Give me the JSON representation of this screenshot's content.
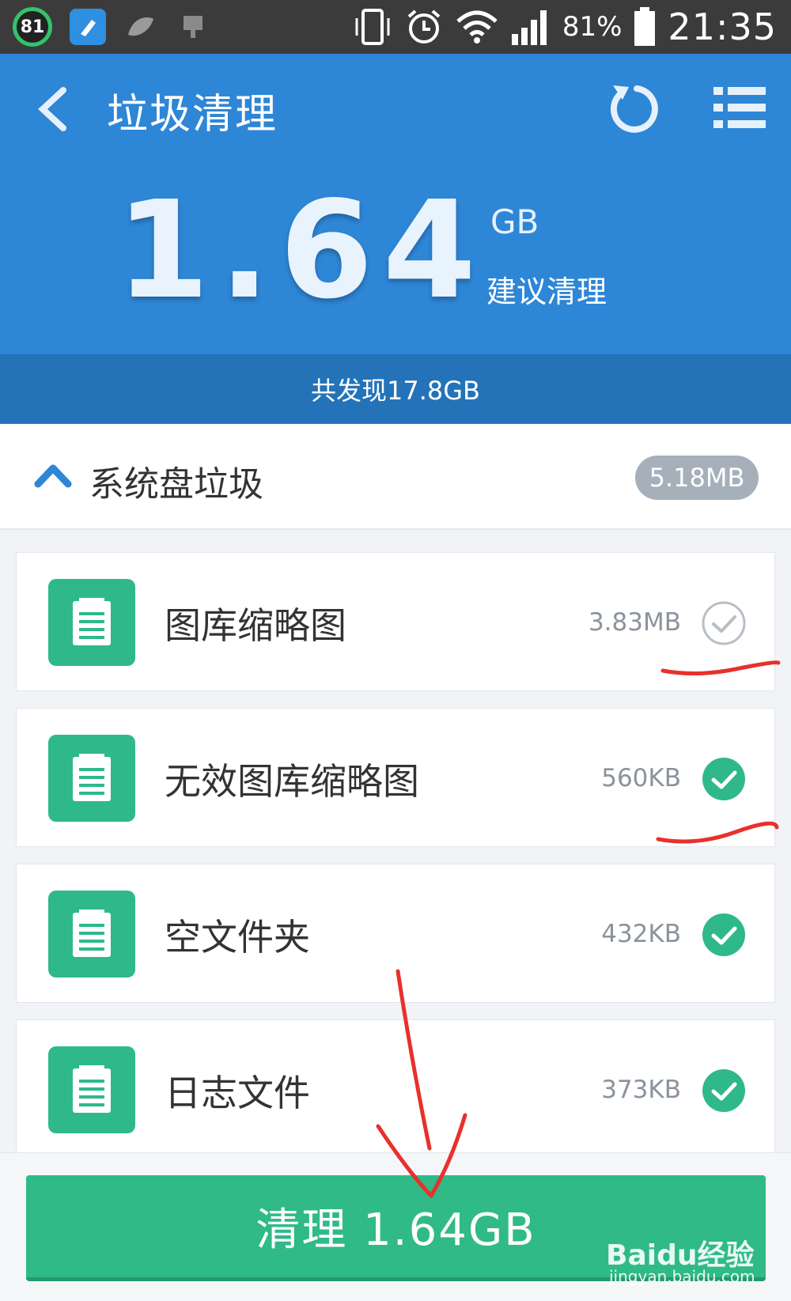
{
  "status_bar": {
    "badge": "81",
    "battery_text": "81%",
    "time": "21:35",
    "icons": [
      "app-badge-icon",
      "cleaner-app-icon",
      "leaf-icon",
      "usb-icon",
      "vibrate-icon",
      "alarm-icon",
      "wifi-icon",
      "signal-icon",
      "battery-icon"
    ]
  },
  "header": {
    "title": "垃圾清理",
    "big_value": "1.64",
    "big_unit": "GB",
    "suggest": "建议清理",
    "found": "共发现17.8GB"
  },
  "category": {
    "title": "系统盘垃圾",
    "size": "5.18MB"
  },
  "items": [
    {
      "label": "图库缩略图",
      "size": "3.83MB",
      "checked": false
    },
    {
      "label": "无效图库缩略图",
      "size": "560KB",
      "checked": true
    },
    {
      "label": "空文件夹",
      "size": "432KB",
      "checked": true
    },
    {
      "label": "日志文件",
      "size": "373KB",
      "checked": true
    }
  ],
  "clean_button": {
    "label": "清理  1.64GB"
  },
  "watermark": {
    "logo": "Baidu经验",
    "url": "jingyan.baidu.com"
  },
  "colors": {
    "header_blue": "#2e86d6",
    "found_bar_blue": "#2473b9",
    "accent_green": "#2fba88",
    "annotation_red": "#e8302c",
    "badge_gray": "#a6b0bb"
  }
}
